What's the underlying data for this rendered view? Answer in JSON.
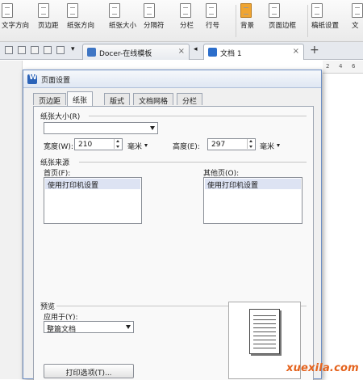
{
  "ribbon": {
    "items": [
      "文字方向",
      "页边距",
      "纸张方向",
      "纸张大小",
      "分隔符",
      "分栏",
      "行号",
      "背景",
      "页面边框",
      "稿纸设置",
      "文"
    ],
    "dropdowns": [
      "▾",
      "▾",
      "▾",
      "▾",
      "▾"
    ],
    "logo_text": "|A"
  },
  "tabbar": {
    "tabs": [
      {
        "label": "Docer-在线模板",
        "close": "×"
      },
      {
        "label": "文档 1",
        "close": "×"
      }
    ],
    "new_tab": "+",
    "arrow": "▾",
    "nav": "◂"
  },
  "ruler": {
    "ticks": [
      "2",
      "4",
      "6"
    ]
  },
  "dialog": {
    "title": "页面设置",
    "tabs": [
      "页边距",
      "纸张",
      "版式",
      "文档网格",
      "分栏"
    ],
    "paper_size": {
      "group_label": "纸张大小(R)",
      "combo_value": "",
      "width_label": "宽度(W):",
      "width_value": "210",
      "width_unit": "毫米",
      "height_label": "高度(E):",
      "height_value": "297",
      "height_unit": "毫米"
    },
    "paper_source": {
      "group_label": "纸张来源",
      "first_page_label": "首页(F):",
      "first_page_item": "使用打印机设置",
      "other_pages_label": "其他页(O):",
      "other_pages_item": "使用打印机设置"
    },
    "preview": {
      "group_label": "预览",
      "apply_label": "应用于(Y):",
      "apply_value": "整篇文档"
    },
    "print_options_button": "打印选项(T)..."
  },
  "watermark": "xuexila.com"
}
